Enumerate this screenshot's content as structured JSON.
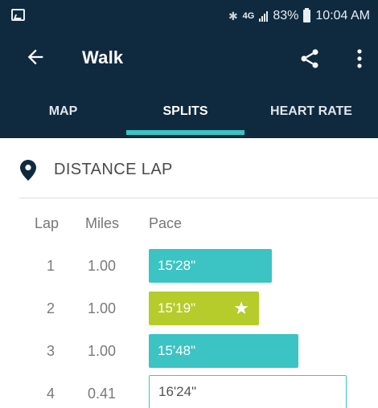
{
  "status_bar": {
    "network": "4G",
    "battery": "83%",
    "time": "10:04 AM",
    "icons": [
      "image-icon",
      "bluetooth-icon",
      "signal-icon",
      "battery-icon"
    ]
  },
  "app_bar": {
    "title": "Walk",
    "icons": [
      "back-arrow-icon",
      "share-icon",
      "more-vert-icon"
    ]
  },
  "tabs": [
    {
      "label": "MAP",
      "active": false
    },
    {
      "label": "SPLITS",
      "active": true
    },
    {
      "label": "HEART RATE",
      "active": false
    }
  ],
  "section": {
    "title": "DISTANCE LAP",
    "icon": "location-pin-icon"
  },
  "table": {
    "headers": {
      "lap": "Lap",
      "miles": "Miles",
      "pace": "Pace"
    },
    "rows": [
      {
        "lap": "1",
        "miles": "1.00",
        "pace": "15'28\"",
        "best": false
      },
      {
        "lap": "2",
        "miles": "1.00",
        "pace": "15'19\"",
        "best": true
      },
      {
        "lap": "3",
        "miles": "1.00",
        "pace": "15'48\"",
        "best": false
      },
      {
        "lap": "4",
        "miles": "0.41",
        "pace": "16'24\"",
        "best": false,
        "partial": true
      }
    ]
  },
  "colors": {
    "header_bg": "#0f2a3f",
    "accent": "#3cc3c3",
    "best": "#b5cc2a"
  }
}
